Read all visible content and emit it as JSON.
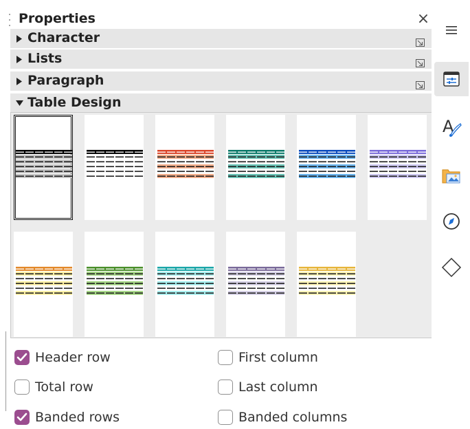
{
  "panel": {
    "title": "Properties",
    "close_glyph": "×"
  },
  "sections": [
    {
      "label": "Character",
      "expanded": false
    },
    {
      "label": "Lists",
      "expanded": false
    },
    {
      "label": "Paragraph",
      "expanded": false
    },
    {
      "label": "Table Design",
      "expanded": true
    }
  ],
  "table_design": {
    "styles": [
      {
        "name": "default",
        "header": "#000000",
        "band": "#c8c8c8",
        "selected": true
      },
      {
        "name": "black-header",
        "header": "#000000",
        "band": null,
        "selected": false
      },
      {
        "name": "orange",
        "header": "#d9462b",
        "band": "#f4b08d",
        "selected": false
      },
      {
        "name": "teal",
        "header": "#0c7a6a",
        "band": "#6cc5b8",
        "selected": false
      },
      {
        "name": "blue",
        "header": "#0c4dbd",
        "band": "#6db7f0",
        "selected": false
      },
      {
        "name": "lavender",
        "header": "#7a6bd9",
        "band": "#d0cbf3",
        "selected": false
      },
      {
        "name": "orange-yellow",
        "header": "#e3892a",
        "band": "#fff2a8",
        "selected": false
      },
      {
        "name": "green",
        "header": "#4a8f2a",
        "band": "#a9d98a",
        "selected": false
      },
      {
        "name": "cyan",
        "header": "#1aa6a8",
        "band": "#aaf0f0",
        "selected": false
      },
      {
        "name": "purple-gray",
        "header": "#7a6a9a",
        "band": "#d8d3e8",
        "selected": false
      },
      {
        "name": "gold",
        "header": "#e6b53a",
        "band": "#fff6b8",
        "selected": false
      }
    ],
    "options": [
      {
        "label": "Header row",
        "checked": true
      },
      {
        "label": "First column",
        "checked": false
      },
      {
        "label": "Total row",
        "checked": false
      },
      {
        "label": "Last column",
        "checked": false
      },
      {
        "label": "Banded rows",
        "checked": true
      },
      {
        "label": "Banded columns",
        "checked": false
      }
    ]
  },
  "sidebar_tabs": [
    {
      "icon": "hamburger-menu-icon",
      "active": false
    },
    {
      "icon": "properties-icon",
      "active": true
    },
    {
      "icon": "styles-icon",
      "active": false
    },
    {
      "icon": "gallery-icon",
      "active": false
    },
    {
      "icon": "navigator-icon",
      "active": false
    },
    {
      "icon": "shapes-icon",
      "active": false
    }
  ],
  "colors": {
    "accent_checkbox": "#9b4d8f",
    "section_bg": "#e6e6e6"
  }
}
